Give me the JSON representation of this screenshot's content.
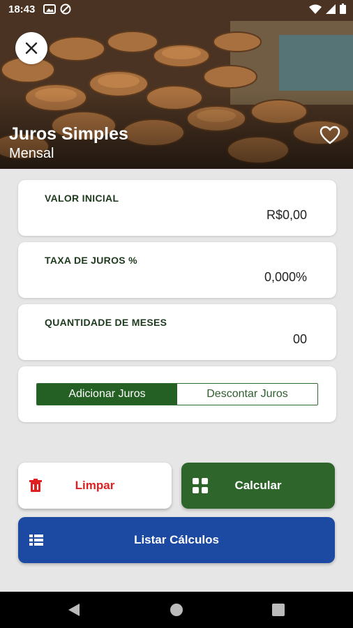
{
  "status": {
    "time": "18:43"
  },
  "header": {
    "title": "Juros Simples",
    "subtitle": "Mensal"
  },
  "fields": [
    {
      "label": "VALOR INICIAL",
      "value": "R$0,00"
    },
    {
      "label": "TAXA DE JUROS %",
      "value": "0,000%"
    },
    {
      "label": "QUANTIDADE DE MESES",
      "value": "00"
    }
  ],
  "mode_toggle": {
    "add_label": "Adicionar Juros",
    "discount_label": "Descontar Juros",
    "selected": "Adicionar Juros"
  },
  "actions": {
    "clear_label": "Limpar",
    "calculate_label": "Calcular",
    "list_label": "Listar Cálculos"
  },
  "colors": {
    "primary_green": "#246023",
    "list_blue": "#1c4aa3",
    "clear_red": "#e02020"
  },
  "icons": [
    "close-icon",
    "heart-outline-icon",
    "trash-icon",
    "calculator-grid-icon",
    "list-icon",
    "back-icon",
    "home-icon",
    "recents-icon"
  ]
}
